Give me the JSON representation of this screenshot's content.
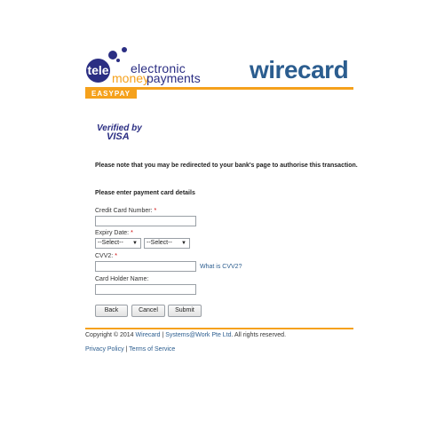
{
  "header": {
    "tele_badge": "tele",
    "brand_line1": "electronic",
    "brand_money": "money",
    "brand_payments": "payments",
    "wirecard_logo": "wirecard",
    "easypay_tab": "EASYPAY"
  },
  "visa": {
    "verified_by": "Verified by",
    "visa": "VISA"
  },
  "notice": "Please note that you may be redirected to your bank's page to authorise this transaction.",
  "form": {
    "section_title": "Please enter payment card details",
    "card_number_label": "Credit Card Number:",
    "expiry_label": "Expiry Date:",
    "month_select": "--Select--",
    "year_select": "--Select--",
    "cvv_label": "CVV2:",
    "cvv_help": "What is CVV2?",
    "holder_label": "Card Holder Name:",
    "required_mark": "*"
  },
  "buttons": {
    "back": "Back",
    "cancel": "Cancel",
    "submit": "Submit"
  },
  "footer": {
    "copyright_prefix": "Copyright © 2014",
    "wirecard_link": "Wirecard",
    "separator": " | ",
    "sw_link": "Systems@Work Pte Ltd",
    "rights": ". All rights reserved.",
    "privacy": "Privacy Policy",
    "terms": "Terms of Service"
  },
  "colors": {
    "brand_blue": "#2b2e83",
    "wirecard_blue": "#2b5d8f",
    "accent_orange": "#f5a11c"
  }
}
